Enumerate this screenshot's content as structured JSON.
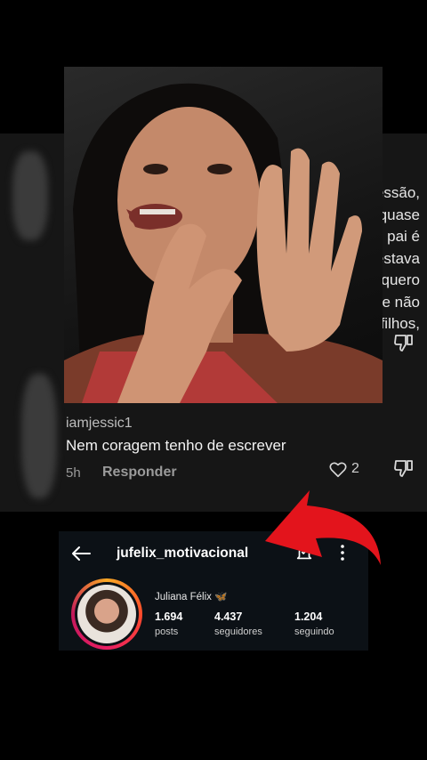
{
  "comments": {
    "behind_text_lines": [
      "mento de mãe, é pessão, quase",
      "o filho, mas deixe o pai é",
      "estava",
      "o quero",
      "e não",
      "filhos,"
    ],
    "comment": {
      "username": "iamjessic1",
      "text": "Nem coragem tenho de escrever",
      "time": "5h",
      "reply_label": "Responder",
      "like_count": "2"
    }
  },
  "profile": {
    "handle": "jufelix_motivacional",
    "display_name": "Juliana Félix 🦋",
    "stats": [
      {
        "value": "1.694",
        "label": "posts"
      },
      {
        "value": "4.437",
        "label": "seguidores"
      },
      {
        "value": "1.204",
        "label": "seguindo"
      }
    ]
  },
  "icons": {
    "back": "arrow-left-icon",
    "bell": "bell-icon",
    "more": "more-vertical-icon",
    "like": "heart-icon",
    "dislike": "thumbs-down-icon"
  },
  "colors": {
    "arrow": "#e3141c",
    "panel": "#161616",
    "card": "#0c1116"
  }
}
